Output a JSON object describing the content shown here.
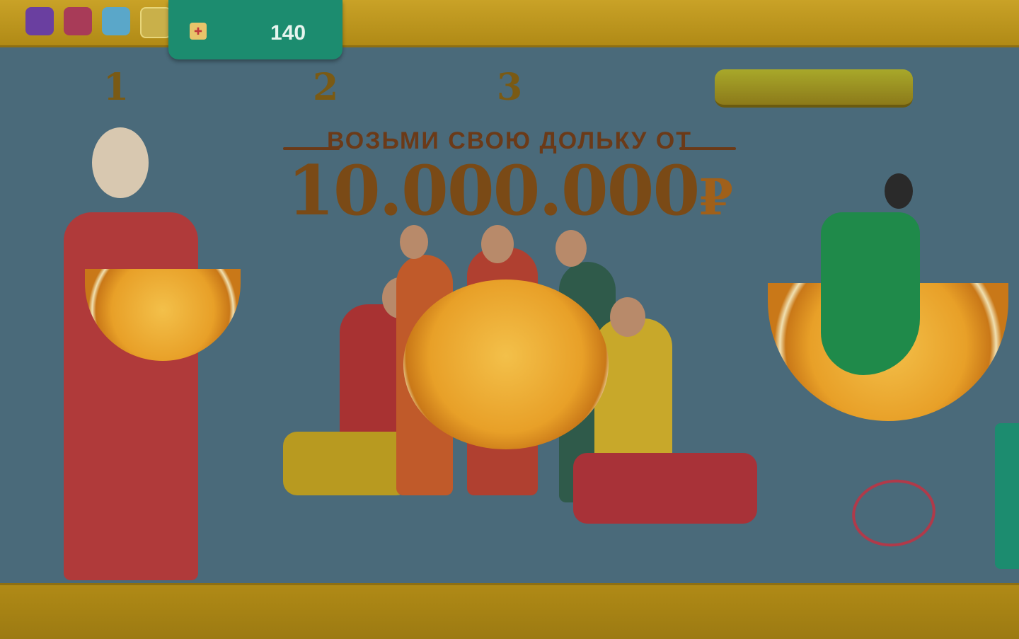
{
  "brand_logos": [
    {
      "name": "brand-logo-1",
      "text": ""
    },
    {
      "name": "brand-logo-2",
      "text": ""
    },
    {
      "name": "brand-logo-3",
      "text": ""
    },
    {
      "name": "brand-logo-4",
      "text": ""
    }
  ],
  "counter": {
    "value": "140"
  },
  "steps": [
    {
      "number": "1"
    },
    {
      "number": "2"
    },
    {
      "number": "3"
    }
  ],
  "hero": {
    "line1": "ВОЗЬМИ СВОЮ ДОЛЬКУ ОТ",
    "amount": "10.000.000",
    "currency": "₽"
  },
  "colors": {
    "nav_bg": "#c9a227",
    "accent_green": "#1c8c6f",
    "cta_bg": "#a8a82a",
    "page_bg": "#4a6a7a"
  }
}
